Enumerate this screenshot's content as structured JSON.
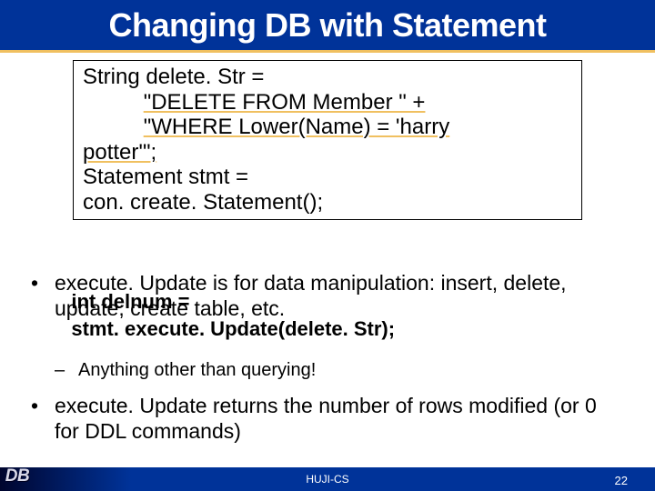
{
  "title": "Changing DB with Statement",
  "code": {
    "l1": "String delete. Str =",
    "l2_indent": "          ",
    "l2": "\"DELETE FROM Member \" +",
    "l3_indent": "          ",
    "l3": "\"WHERE Lower(Name) = 'harry",
    "l4": "potter'\";",
    "l5": "Statement stmt =",
    "l6": "con. create. Statement();"
  },
  "overlay1": "   int delnum =",
  "overlay2": "   stmt. execute. Update(delete. Str);",
  "bullet1": "execute. Update is for data manipulation: insert, delete, update, create table, etc.",
  "sub1": "Anything other than querying!",
  "bullet2": "execute. Update returns the number of rows modified (or 0 for DDL commands)",
  "footer_center": "HUJI-CS",
  "slide_number": "22",
  "db_label": "DB"
}
